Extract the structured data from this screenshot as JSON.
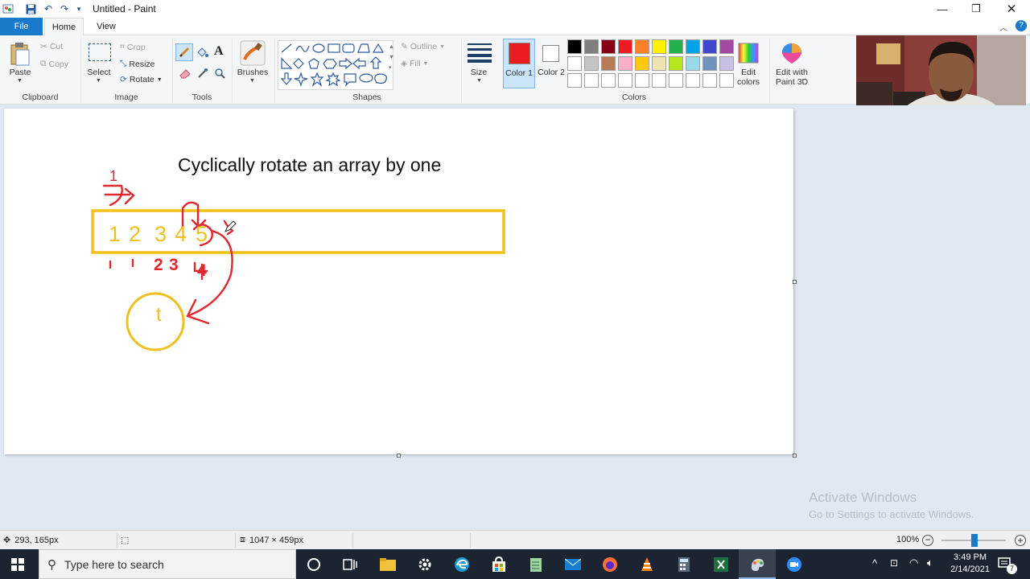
{
  "window": {
    "title": "Untitled - Paint"
  },
  "tabs": {
    "file": "File",
    "home": "Home",
    "view": "View"
  },
  "ribbon": {
    "clipboard": {
      "paste": "Paste",
      "cut": "Cut",
      "copy": "Copy",
      "label": "Clipboard"
    },
    "image": {
      "select": "Select",
      "crop": "Crop",
      "resize": "Resize",
      "rotate": "Rotate",
      "label": "Image"
    },
    "tools": {
      "label": "Tools"
    },
    "brushes": {
      "label": "Brushes"
    },
    "shapes": {
      "outline": "Outline",
      "fill": "Fill",
      "label": "Shapes"
    },
    "size": {
      "label": "Size"
    },
    "colors": {
      "color1_label": "Color 1",
      "color2_label": "Color 2",
      "color1": "#ed1c24",
      "color2": "#ffffff",
      "edit_colors": "Edit colors",
      "label": "Colors",
      "palette_row1": [
        "#000000",
        "#7f7f7f",
        "#880015",
        "#ed1c24",
        "#ff7f27",
        "#fff200",
        "#22b14c",
        "#00a2e8",
        "#3f48cc",
        "#a349a4"
      ],
      "palette_row2": [
        "#ffffff",
        "#c3c3c3",
        "#b97a57",
        "#ffaec9",
        "#ffc90e",
        "#efe4b0",
        "#b5e61d",
        "#99d9ea",
        "#7092be",
        "#c8bfe7"
      ]
    },
    "paint3d": {
      "label": "Edit with Paint 3D"
    }
  },
  "canvas": {
    "heading": "Cyclically rotate an array by one",
    "array_values": [
      "1",
      "2",
      "3",
      "4",
      "5"
    ],
    "temp_label": "t",
    "annotations_top": "1",
    "annotations_below": [
      "1",
      "1",
      "2",
      "3",
      "4"
    ]
  },
  "watermark": {
    "line1": "Activate Windows",
    "line2": "Go to Settings to activate Windows."
  },
  "status": {
    "cursor_pos": "293, 165px",
    "canvas_size": "1047 × 459px",
    "zoom": "100%"
  },
  "taskbar": {
    "search_placeholder": "Type here to search",
    "time": "3:49 PM",
    "date": "2/14/2021",
    "notification_count": "7"
  }
}
